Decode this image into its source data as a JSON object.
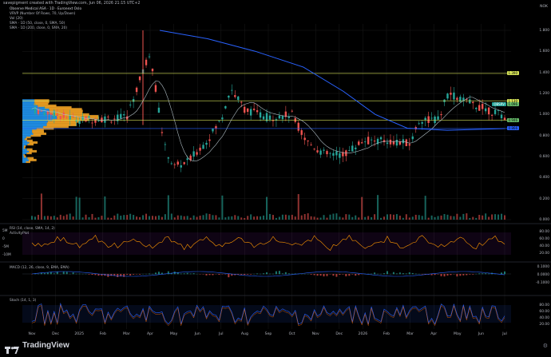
{
  "header": {
    "watermark": "savepigment created with TradingView.com, Jun 06, 2026 21:15 UTC+2",
    "symbol_line": "Observe Medical ASA · 1D · Euronext Oslo",
    "vrvp_line": "VRVP (Number Of Rows, 70, Up/Down)",
    "vol_line": "Vol (20)",
    "sma1_line": "SMA · 1D (50, close, 0, SMA, 50)",
    "sma2_line": "SMA · 1D (200, close, 0, SMA, 20)",
    "currency": "NOK"
  },
  "price_axis": {
    "labels": [
      "1.800",
      "1.600",
      "1.400",
      "1.200",
      "1.000",
      "0.800",
      "0.600",
      "0.400",
      "0.200",
      "0.000"
    ],
    "tags": [
      {
        "text": "1.390",
        "color": "#d4e157"
      },
      {
        "text": "1.130",
        "color": "#d4e157"
      },
      {
        "text": "1.096",
        "color": "#66bb6a"
      },
      {
        "text": "0.946",
        "color": "#66bb6a"
      },
      {
        "text": "0.866",
        "color": "#2962ff"
      }
    ],
    "last_price_tag": "OBSRV"
  },
  "rsi_pane": {
    "label": "RSI (14, close, SMA, 14, 2)",
    "label2": "ActivityPlot",
    "axis": [
      "80.00",
      "60.00",
      "40.00",
      "20.00"
    ],
    "left_axis": [
      "5M",
      "0",
      "-5M",
      "-10M"
    ]
  },
  "macd_pane": {
    "label": "MACD (12, 26, close, 9, EMA, EMA)",
    "axis": [
      "0.1000",
      "0.0000",
      "-0.1000"
    ]
  },
  "stoch_pane": {
    "label": "Stoch (14, 1, 3)",
    "axis": [
      "80.00",
      "60.00",
      "40.00",
      "20.00"
    ]
  },
  "time_axis": [
    "Nov",
    "Dec",
    "2025",
    "Feb",
    "Mar",
    "Apr",
    "May",
    "Jun",
    "Jul",
    "Aug",
    "Sep",
    "Oct",
    "Nov",
    "Dec",
    "2026",
    "Feb",
    "Mar",
    "Apr",
    "May",
    "Jun",
    "Jul"
  ],
  "branding": {
    "name": "TradingView"
  },
  "colors": {
    "up": "#26a69a",
    "down": "#ef5350",
    "sma50": "#b0bec5",
    "sma200": "#2962ff",
    "vp_up": "#2196f3",
    "vp_down": "#f9a825",
    "level_line": "#d4e157",
    "rsi": "#ff9800",
    "stoch": "#2962ff"
  }
}
